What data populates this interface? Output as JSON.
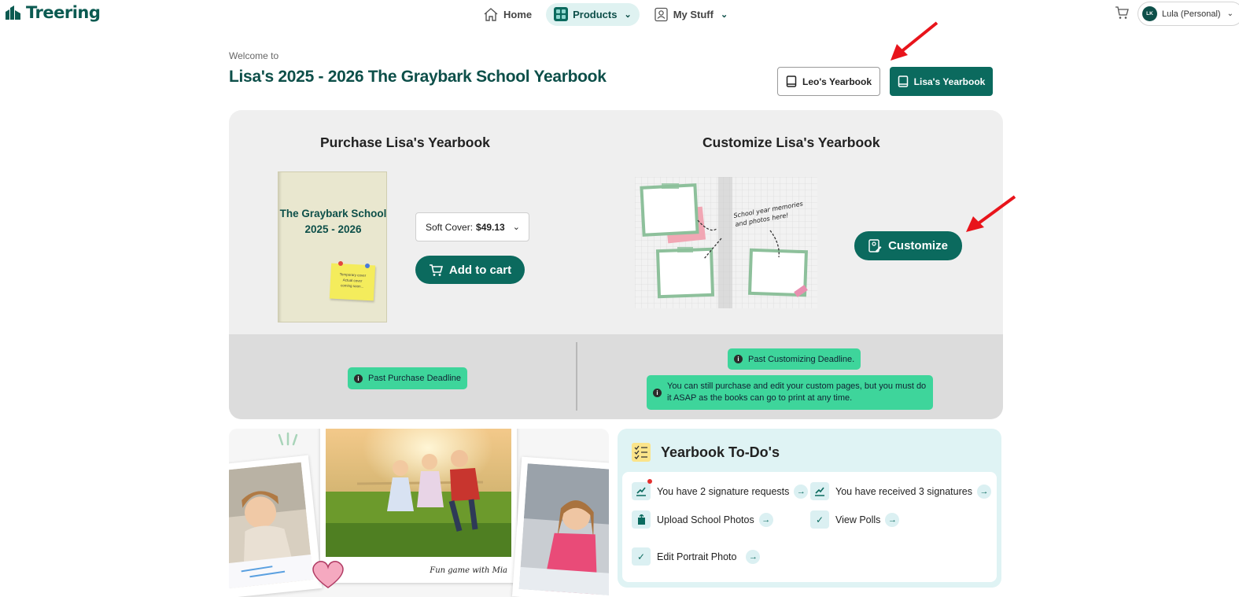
{
  "brand": {
    "name": "Treering"
  },
  "nav": {
    "home": "Home",
    "products": "Products",
    "my_stuff": "My Stuff"
  },
  "account": {
    "initials": "LK",
    "name": "Lula (Personal)"
  },
  "header": {
    "welcome": "Welcome to",
    "title": "Lisa's 2025 - 2026 The Graybark School Yearbook"
  },
  "yearbook_switch": {
    "leo": "Leo's Yearbook",
    "lisa": "Lisa's Yearbook"
  },
  "purchase": {
    "title": "Purchase Lisa's Yearbook",
    "cover_title_line1": "The Graybark School",
    "cover_title_line2": "2025 - 2026",
    "sticky_line1": "Temporary cover",
    "sticky_line2": "Actual cover",
    "sticky_line3": "coming soon...",
    "cover_option_label": "Soft Cover:",
    "cover_option_price": "$49.13",
    "add_to_cart": "Add to cart",
    "deadline_badge": "Past Purchase Deadline"
  },
  "customize": {
    "title": "Customize Lisa's Yearbook",
    "book_note_line1": "School year memories",
    "book_note_line2": "and photos here!",
    "button": "Customize",
    "deadline_badge": "Past Customizing Deadline.",
    "notice": "You can still purchase and edit your custom pages, but you must do it ASAP as the books can go to print at any time."
  },
  "collage": {
    "caption": "Fun game with Mia"
  },
  "todo": {
    "title": "Yearbook To-Do's",
    "items": [
      {
        "label": "You have 2 signature requests"
      },
      {
        "label": "You have received 3 signatures"
      },
      {
        "label": "Upload School Photos"
      },
      {
        "label": "View Polls"
      },
      {
        "label": "Edit Portrait Photo"
      }
    ]
  },
  "colors": {
    "brand": "#0b5a51",
    "primary_button": "#0b6a5e",
    "badge": "#3ed59b",
    "todo_bg": "#dff3f4",
    "annotation_arrow": "#e8141b"
  }
}
